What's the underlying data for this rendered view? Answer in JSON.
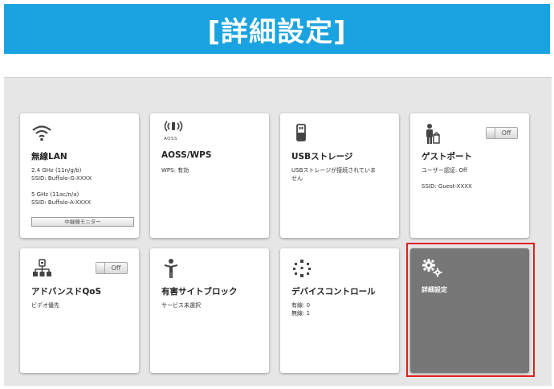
{
  "banner": {
    "title": "[詳細設定]"
  },
  "tiles": {
    "wlan": {
      "title": "無線LAN",
      "line1": "2.4 GHz (11n/g/b)",
      "line2": "SSID: Buffalo-G-XXXX",
      "line3": "5 GHz (11ac/n/a)",
      "line4": "SSID: Buffalo-A-XXXX",
      "button": "中継機モニター",
      "icon": "wifi-icon"
    },
    "aoss": {
      "title": "AOSS/WPS",
      "icon_label": "AOSS",
      "line1": "WPS: 有効",
      "icon": "aoss-wireless-icon"
    },
    "usb": {
      "title": "USBストレージ",
      "line1": "USBストレージが接続されていま",
      "line2": "せん",
      "icon": "usb-drive-icon"
    },
    "guest": {
      "title": "ゲストポート",
      "toggle": "Off",
      "line1": "ユーザー認証: Off",
      "line2": "SSID: Guest-XXXX",
      "icon": "guest-user-icon"
    },
    "qos": {
      "title": "アドバンスドQoS",
      "toggle": "Off",
      "line1": "ビデオ優先",
      "icon": "qos-network-icon"
    },
    "block": {
      "title": "有害サイトブロック",
      "line1": "サービス未選択",
      "icon": "child-person-icon"
    },
    "device": {
      "title": "デバイスコントロール",
      "line1": "有線: 0",
      "line2": "無線: 1",
      "icon": "device-dots-icon"
    },
    "advanced": {
      "title": "詳細設定",
      "icon": "gears-icon"
    }
  },
  "colors": {
    "banner": "#1aa3e0",
    "highlight": "#e0201b",
    "dark_tile": "#777777"
  }
}
